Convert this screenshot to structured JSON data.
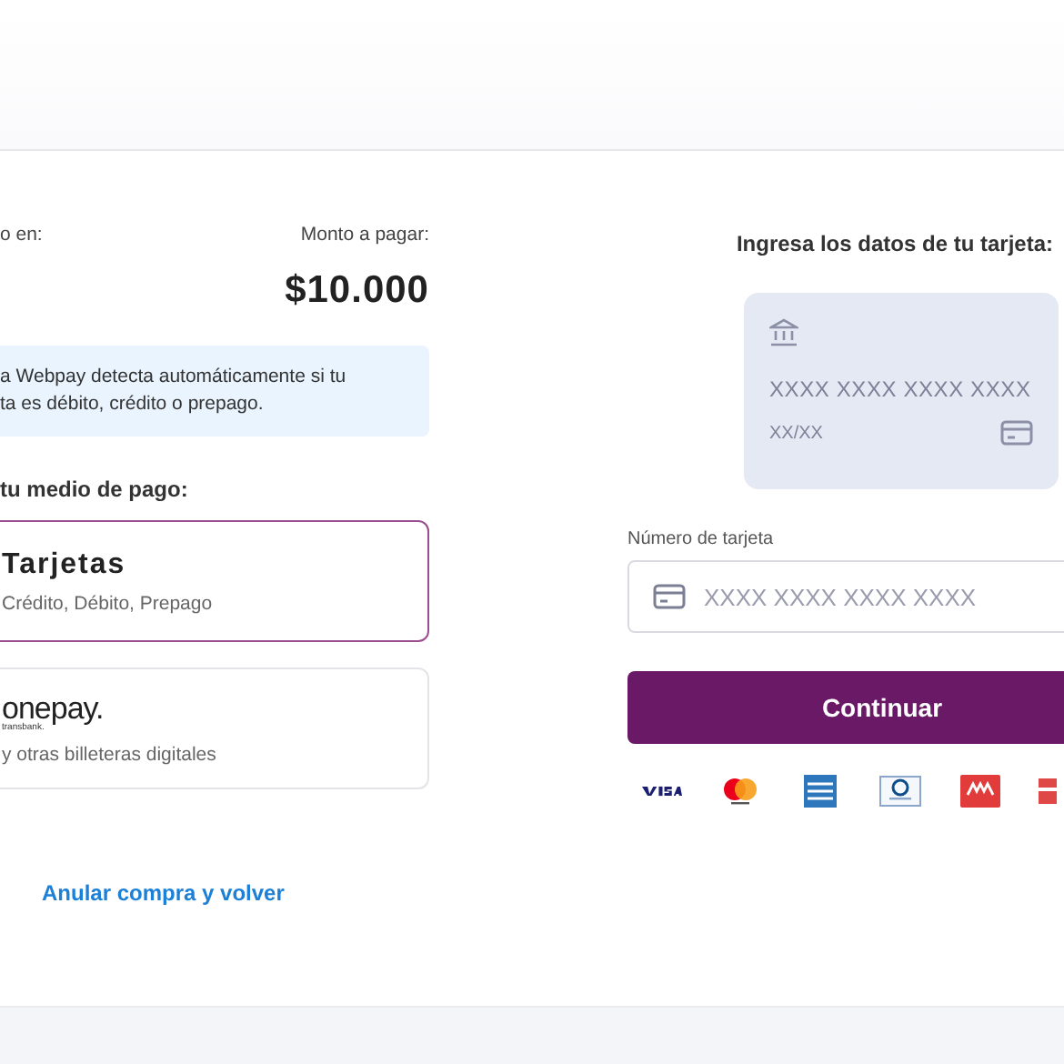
{
  "summary": {
    "merchant_label": "o en:",
    "amount_label": "Monto a pagar:",
    "amount": "$10.000"
  },
  "notice": {
    "lines": [
      "a Webpay detecta automáticamente si tu",
      "ta es débito, crédito o prepago."
    ]
  },
  "payment_methods": {
    "title": "tu medio de pago:",
    "options": [
      {
        "kind": "text",
        "title": "Tarjetas",
        "subtitle": "Crédito, Débito, Prepago",
        "selected": true
      },
      {
        "kind": "logo",
        "title": "onepay.",
        "logo_sub": "transbank.",
        "subtitle": "y otras billeteras digitales",
        "selected": false
      }
    ]
  },
  "cancel_link": "Anular compra y volver",
  "card_form": {
    "title": "Ingresa los datos de tu tarjeta:",
    "card_face_digits": "XXXX XXXX XXXX XXXX",
    "card_face_date": "XX/XX",
    "field_label": "Número de tarjeta",
    "field_placeholder": "XXXX XXXX XXXX XXXX",
    "submit": "Continuar"
  },
  "card_brands": [
    {
      "kind": "visa"
    },
    {
      "kind": "mastercard"
    },
    {
      "kind": "amex"
    },
    {
      "kind": "diners"
    },
    {
      "kind": "magna"
    },
    {
      "kind": "other"
    }
  ]
}
